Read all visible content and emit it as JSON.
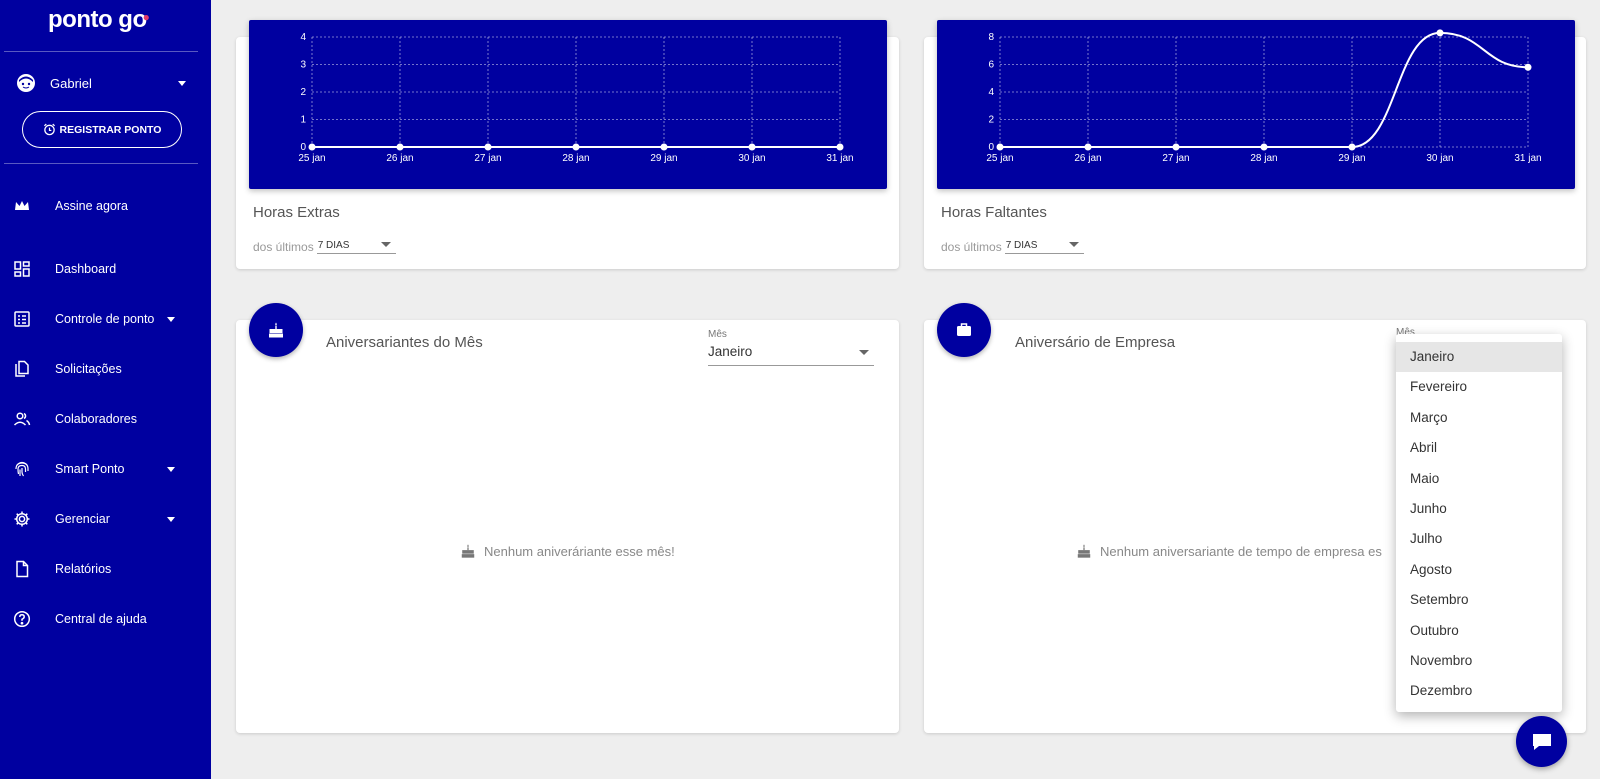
{
  "app": {
    "logo": "ponto go"
  },
  "user": {
    "name": "Gabriel"
  },
  "sidebar": {
    "register_label": "REGISTRAR PONTO",
    "items": [
      {
        "label": "Assine agora",
        "icon": "crown-icon"
      },
      {
        "label": "Dashboard",
        "icon": "dashboard-icon"
      },
      {
        "label": "Controle de ponto",
        "icon": "timesheet-icon",
        "expandable": true
      },
      {
        "label": "Solicitações",
        "icon": "documents-icon"
      },
      {
        "label": "Colaboradores",
        "icon": "people-icon"
      },
      {
        "label": "Smart Ponto",
        "icon": "fingerprint-icon",
        "expandable": true
      },
      {
        "label": "Gerenciar",
        "icon": "gear-icon",
        "expandable": true
      },
      {
        "label": "Relatórios",
        "icon": "file-icon"
      },
      {
        "label": "Central de ajuda",
        "icon": "help-icon"
      }
    ]
  },
  "cards": {
    "extras": {
      "title": "Horas Extras",
      "period_prefix": "dos últimos",
      "period_value": "7 DIAS"
    },
    "faltantes": {
      "title": "Horas Faltantes",
      "period_prefix": "dos últimos",
      "period_value": "7 DIAS"
    },
    "aniversariantes": {
      "title": "Aniversariantes do Mês",
      "field_label": "Mês",
      "field_value": "Janeiro",
      "empty": "Nenhum aniveráriante esse mês!"
    },
    "empresa": {
      "title": "Aniversário de Empresa",
      "field_label": "Mês",
      "empty": "Nenhum aniversariante de tempo de empresa es"
    }
  },
  "dropdown": {
    "selected": "Janeiro",
    "options": [
      "Janeiro",
      "Fevereiro",
      "Março",
      "Abril",
      "Maio",
      "Junho",
      "Julho",
      "Agosto",
      "Setembro",
      "Outubro",
      "Novembro",
      "Dezembro"
    ]
  },
  "colors": {
    "brand": "#0000a0",
    "accent": "#e23a6a"
  },
  "chart_data": [
    {
      "type": "line",
      "x": [
        "25 jan",
        "26 jan",
        "27 jan",
        "28 jan",
        "29 jan",
        "30 jan",
        "31 jan"
      ],
      "yticks": [
        "0",
        "1",
        "2",
        "3",
        "4"
      ],
      "ylim": [
        0,
        4
      ],
      "series": [
        {
          "values": [
            0,
            0,
            0,
            0,
            0,
            0,
            0
          ]
        }
      ],
      "grid": true
    },
    {
      "type": "line",
      "x": [
        "25 jan",
        "26 jan",
        "27 jan",
        "28 jan",
        "29 jan",
        "30 jan",
        "31 jan"
      ],
      "yticks": [
        "0",
        "2",
        "4",
        "6",
        "8"
      ],
      "ylim": [
        0,
        8
      ],
      "series": [
        {
          "values": [
            0,
            0,
            0,
            0,
            0,
            8.3,
            5.8
          ]
        }
      ],
      "grid": true
    }
  ]
}
